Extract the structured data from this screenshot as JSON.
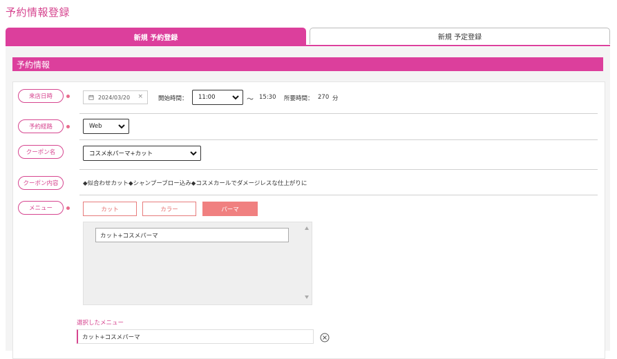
{
  "page": {
    "title": "予約情報登録"
  },
  "tabs": [
    {
      "label": "新規 予約登録",
      "active": true
    },
    {
      "label": "新規 予定登録",
      "active": false
    }
  ],
  "section": {
    "title": "予約情報"
  },
  "fields": {
    "visit_datetime": {
      "label": "来店日時",
      "date_value": "2024/03/20",
      "clear_symbol": "×",
      "start_time_label": "開始時間：",
      "start_time_value": "11:00",
      "tilde": "〜",
      "end_time": "15:30",
      "duration_label": "所要時間：",
      "duration_value": "270",
      "duration_unit": "分"
    },
    "booking_route": {
      "label": "予約経路",
      "value": "Web"
    },
    "coupon_name": {
      "label": "クーポン名",
      "value": "コスメ水パーマ+カット"
    },
    "coupon_content": {
      "label": "クーポン内容",
      "text": "◆似合わせカット◆シャンプーブロー込み◆コスメカールでダメージレスな仕上がりに"
    },
    "menu": {
      "label": "メニュー",
      "categories": [
        {
          "label": "カット",
          "active": false
        },
        {
          "label": "カラー",
          "active": false
        },
        {
          "label": "パーマ",
          "active": true
        }
      ],
      "list_items": [
        "カット+コスメパーマ"
      ],
      "selected_label": "選択したメニュー",
      "selected_items": [
        "カット+コスメパーマ"
      ]
    }
  },
  "colors": {
    "accent": "#dc3f9c",
    "menu_active": "#f08080",
    "required_dot": "#e86b8c"
  },
  "icons": {
    "date": "calendar-icon",
    "select": "chevron-down-icon",
    "remove": "circle-x-icon"
  }
}
